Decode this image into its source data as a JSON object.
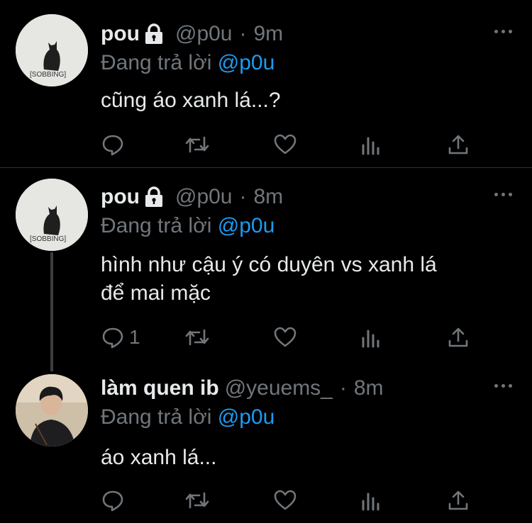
{
  "tweets": [
    {
      "name": "pou",
      "handle": "@p0u",
      "dot": "·",
      "time": "9m",
      "reply_prefix": "Đang trả lời",
      "reply_to": "@p0u",
      "text": "cũng áo xanh lá...?",
      "avatar_caption": "[SOBBING]",
      "reply_count": ""
    },
    {
      "name": "pou",
      "handle": "@p0u",
      "dot": "·",
      "time": "8m",
      "reply_prefix": "Đang trả lời",
      "reply_to": "@p0u",
      "text": "hình như cậu ý có duyên vs xanh lá\nđể mai mặc",
      "avatar_caption": "[SOBBING]",
      "reply_count": "1"
    },
    {
      "name": "làm quen ib",
      "handle": "@yeuems_",
      "dot": "·",
      "time": "8m",
      "reply_prefix": "Đang trả lời",
      "reply_to": "@p0u",
      "text": "áo xanh lá...",
      "reply_count": ""
    }
  ],
  "colors": {
    "background": "#000000",
    "text": "#e7e9ea",
    "muted": "#71767b",
    "link": "#1d9bf0"
  },
  "icons": [
    "lock-icon",
    "more-icon",
    "reply-icon",
    "retweet-icon",
    "like-icon",
    "analytics-icon",
    "share-icon"
  ]
}
